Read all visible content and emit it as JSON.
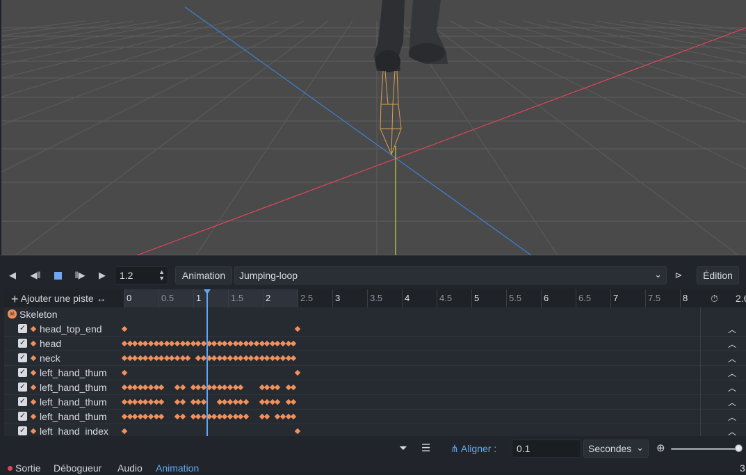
{
  "viewport": {
    "colors": {
      "background": "#4a4a4a",
      "grid": "#5c5c5c",
      "x_axis": "#e0455a",
      "z_axis": "#3b82d6",
      "y_axis": "#c8d43a",
      "bone": "#d9a14e"
    }
  },
  "toolbar": {
    "buttons": [
      "play-backward-icon",
      "play-backward-from-end-icon",
      "stop-icon",
      "play-from-start-icon",
      "play-icon"
    ],
    "time_value": "1.2",
    "animation_menu_label": "Animation",
    "animation_name": "Jumping-loop",
    "edit_label": "Édition"
  },
  "timeline": {
    "add_track_label": "Ajouter une piste",
    "ticks": [
      "0",
      "0.5",
      "1",
      "1.5",
      "2",
      "2.5",
      "3",
      "3.5",
      "4",
      "4.5",
      "5",
      "5.5",
      "6",
      "6.5",
      "7",
      "7.5",
      "8"
    ],
    "length_value": "2.6",
    "playhead_time": 1.2,
    "animation_length": 2.5
  },
  "tracks": {
    "group_name": "Skeleton",
    "rows": [
      {
        "name": "head_top_end",
        "keys": "ends"
      },
      {
        "name": "head",
        "keys": "dense"
      },
      {
        "name": "neck",
        "keys": "dense_gap"
      },
      {
        "name": "left_hand_thum",
        "keys": "ends"
      },
      {
        "name": "left_hand_thum",
        "keys": "pattern_a"
      },
      {
        "name": "left_hand_thum",
        "keys": "pattern_b"
      },
      {
        "name": "left_hand_thum",
        "keys": "pattern_c"
      },
      {
        "name": "left_hand_index",
        "keys": "ends"
      }
    ]
  },
  "bottombar": {
    "snap_label": "Aligner :",
    "snap_value": "0.1",
    "unit_value": "Secondes",
    "zoom_level": 0.95
  },
  "statusbar": {
    "items": [
      "Sortie",
      "Débogueur",
      "Audio",
      "Animation"
    ],
    "active": "Animation",
    "right_text": "3"
  },
  "colors": {
    "accent": "#5fa8f5",
    "keyframe": "#f0905a",
    "panel": "#21252b"
  }
}
